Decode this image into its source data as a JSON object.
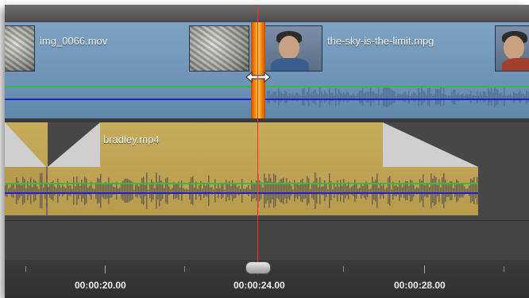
{
  "timeline": {
    "track1": {
      "clips": [
        {
          "label": "img_0066.mov"
        },
        {
          "label": "the-sky-is-the-limit.mpg"
        }
      ]
    },
    "track2": {
      "clips": [
        {
          "label": "bradley.mp4"
        }
      ]
    },
    "ruler": {
      "labels": [
        "00:00:20.00",
        "00:00:24.00",
        "00:00:28.00"
      ]
    }
  },
  "colors": {
    "video_track": "#6e93b6",
    "audio_clip": "#b89a4c",
    "volume_line": "#2fbf3a",
    "pan_line": "#1c22c8",
    "playhead": "#ff2a2a",
    "transition": "#ff9a1a"
  },
  "icons": {
    "trim_cursor": "double-arrow-horizontal",
    "playhead_handle": "scrubber-knob"
  }
}
